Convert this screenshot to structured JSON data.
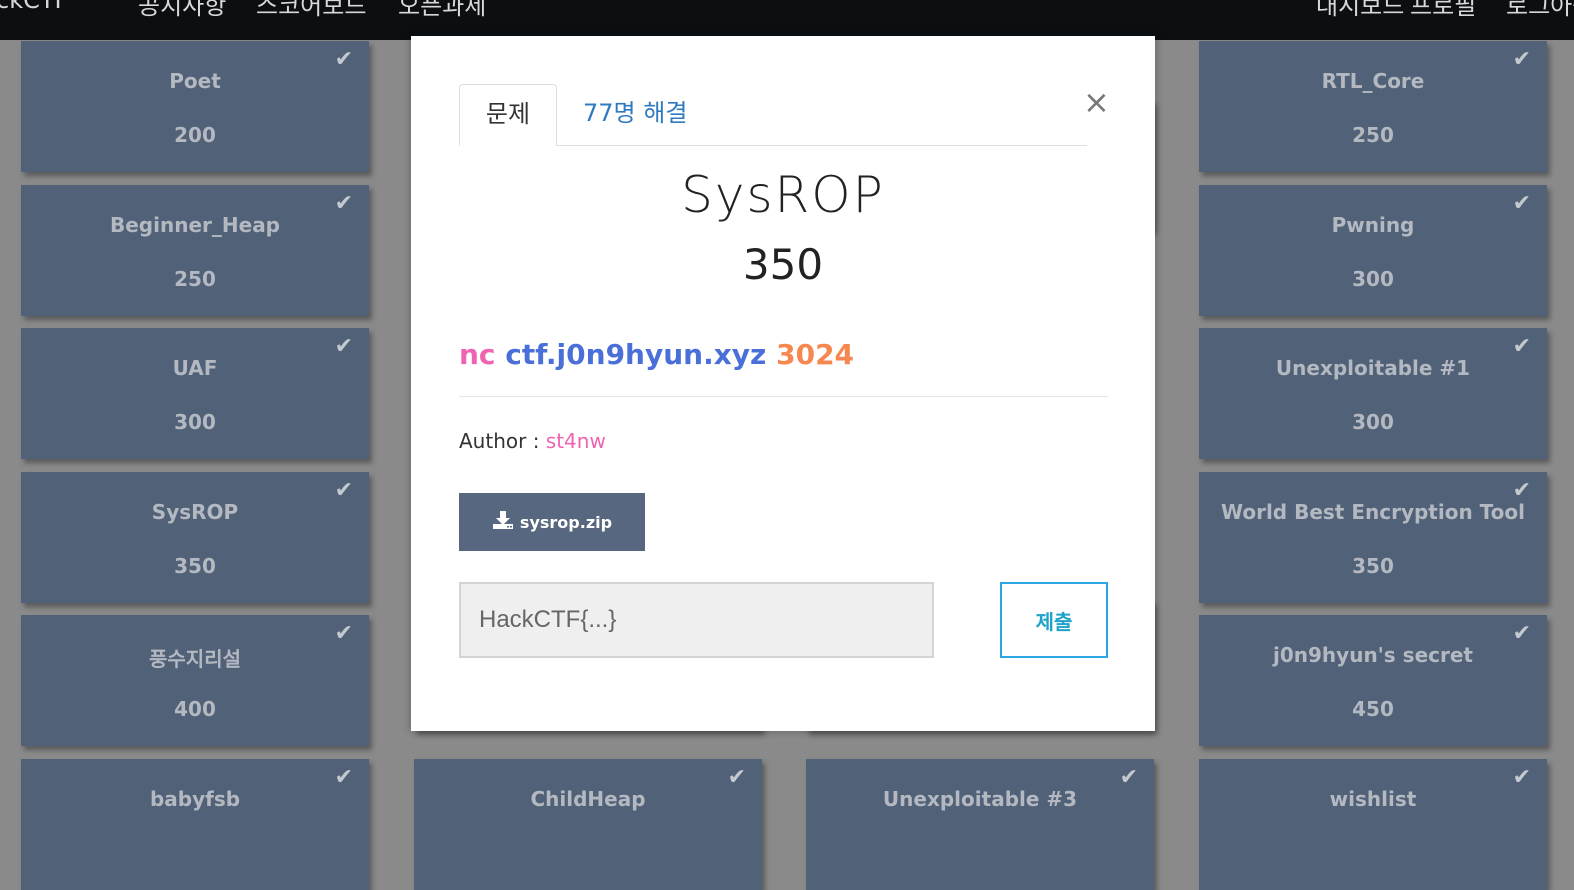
{
  "navbar": {
    "brand": "ckCTF",
    "left_items": [
      "공지사항",
      "스코어보드",
      "오픈과제"
    ],
    "right_items": [
      "대시보드",
      "프로필",
      "로그아웃"
    ]
  },
  "cards": {
    "col1": [
      {
        "name": "Poet",
        "points": "200"
      },
      {
        "name": "Beginner_Heap",
        "points": "250"
      },
      {
        "name": "UAF",
        "points": "300"
      },
      {
        "name": "SysROP",
        "points": "350"
      },
      {
        "name": "풍수지리설",
        "points": "400"
      },
      {
        "name": "babyfsb",
        "points": ""
      }
    ],
    "col2": [
      {
        "name": "ChildHeap",
        "points": ""
      }
    ],
    "col3": [
      {
        "name": "Unexploitable #3",
        "points": ""
      }
    ],
    "col4": [
      {
        "name": "RTL_Core",
        "points": "250"
      },
      {
        "name": "Pwning",
        "points": "300"
      },
      {
        "name": "Unexploitable #1",
        "points": "300"
      },
      {
        "name": "World Best Encryption Tool",
        "points": "350"
      },
      {
        "name": "j0n9hyun's secret",
        "points": "450"
      },
      {
        "name": "wishlist",
        "points": ""
      }
    ],
    "check_icon": "check-icon"
  },
  "modal": {
    "tabs": {
      "problem": "문제",
      "solves": "77명 해결"
    },
    "close_label": "×",
    "title": "SysROP",
    "points": "350",
    "connection": {
      "cmd": "nc",
      "host": "ctf.j0n9hyun.xyz",
      "port": "3024",
      "colors": {
        "cmd": "#f063b0",
        "host": "#4a6fd8",
        "port": "#f5874f"
      }
    },
    "author_label": "Author : ",
    "author_name": "st4nw",
    "download_label": "sysrop.zip",
    "download_icon": "download-icon",
    "flag_placeholder": "HackCTF{...}",
    "flag_value": "",
    "submit_label": "제출"
  },
  "colors": {
    "card_bg": "#506178",
    "overlay_bg": "#8a8a8a",
    "accent": "#2aa7e2",
    "download_bg": "#57677f"
  }
}
